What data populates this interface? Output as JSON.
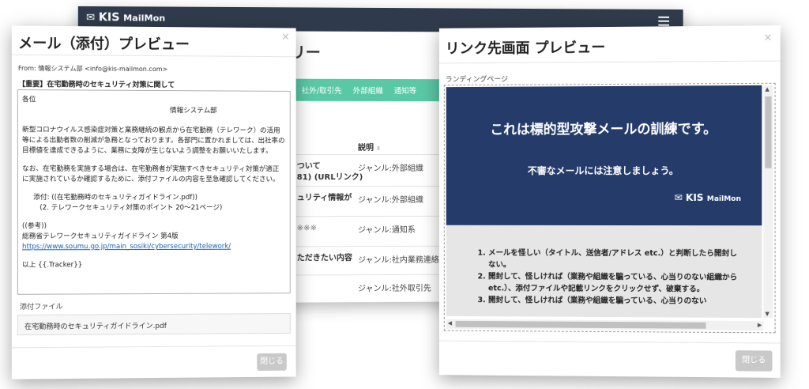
{
  "bg_app": {
    "logo_kis": "KIS",
    "logo_mail": "MailMon",
    "title_partial": "リー",
    "tabs": [
      "社外/取引先",
      "外部組織",
      "通知等"
    ],
    "table_header": "説明",
    "rows": [
      {
        "left": "ついて\n81) (URLリンク)",
        "right": "ジャンル:外部組織"
      },
      {
        "left": "ュリティ情報が",
        "right": "ジャンル:外部組織"
      },
      {
        "left": "※※※",
        "right": "ジャンル:通知系"
      },
      {
        "left": "ただきたい内容",
        "right": "ジャンル:社内業務連絡"
      },
      {
        "left": "",
        "right": "ジャンル:社外取引先"
      }
    ]
  },
  "mail_modal": {
    "title": "メール（添付）プレビュー",
    "close_x": "×",
    "from_label": "From:",
    "from_value": "情報システム部 <info@kis-mailmon.com>",
    "subject": "【重要】在宅勤務時のセキュリティ対策に関して",
    "body": {
      "greeting": "各位",
      "sender": "情報システム部",
      "para1": "新型コロナウイルス感染症対策と業務継続の観点から在宅勤務（テレワーク）の活用等による出勤者数の削減が急務となっております。各部門に置かれましては、出社率の目標値を達成できるように、業務に支障が生じないよう調整をお願いいたします。",
      "para2": "なお、在宅勤務を実施する場合は、在宅勤務者が実施すべきセキュリティ対策が適正に実施されているか確認するために、添付ファイルの内容を至急確認してください。",
      "attach1": "添付: ((在宅勤務時のセキュリティガイドライン.pdf))",
      "attach2": "(2. テレワークセキュリティ対策のポイント 20〜21ページ)",
      "ref": "((参考))",
      "ref_title": "総務省テレワークセキュリティガイドライン 第4版",
      "ref_link": "https://www.soumu.go.jp/main_sosiki/cybersecurity/telework/",
      "closing": "以上 {{.Tracker}}"
    },
    "attachment_label": "添付ファイル",
    "attachment_name": "在宅勤務時のセキュリティガイドライン.pdf",
    "close_button": "閉じる"
  },
  "link_modal": {
    "title": "リンク先画面 プレビュー",
    "close_x": "×",
    "landing_label": "ランディングページ",
    "headline": "これは標的型攻撃メールの訓練です。",
    "subheadline": "不審なメールには注意しましょう。",
    "logo_kis": "KIS",
    "logo_mail": "MailMon",
    "list": [
      "メールを怪しい（タイトル、送信者/アドレス etc.）と判断したら開封しない。",
      "開封して、怪しければ（業務や組織を騙っている、心当りのない組織から etc.）、添付ファイルや記載リンクをクリックせず、破棄する。",
      "開封して、怪しければ（業務や組織を騙っている、心当りのない"
    ],
    "close_button": "閉じる"
  },
  "colors": {
    "nav": "#2f3b4c",
    "tabs": "#59c9a5",
    "hero": "#253c6b",
    "link": "#1a5fb4"
  }
}
